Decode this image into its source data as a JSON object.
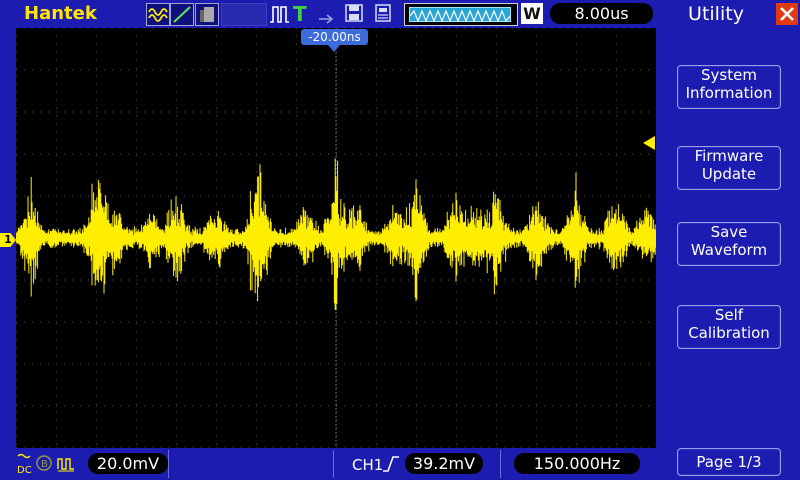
{
  "brand": "Hantek",
  "header": {
    "timebase": "8.00us",
    "memory_depth_label": "W",
    "trigger_status_icon": "T"
  },
  "screen": {
    "trigger_position": "-20.00ns",
    "channel_marker": "1"
  },
  "footer": {
    "ch1_coupling": "DC",
    "ch1_vdiv": "20.0mV",
    "trigger_source": "CH1",
    "trigger_level": "39.2mV",
    "frequency": "150.000Hz"
  },
  "menu": {
    "title": "Utility",
    "items": [
      {
        "line1": "System",
        "line2": "Information"
      },
      {
        "line1": "Firmware",
        "line2": "Update"
      },
      {
        "line1": "Save",
        "line2": "Waveform"
      },
      {
        "line1": "Self",
        "line2": "Calibration"
      }
    ],
    "page": "Page 1/3"
  },
  "colors": {
    "background": "#1c1cb0",
    "trace": "#ffee00",
    "screen": "#000000",
    "close": "#e03a12",
    "trigger_marker": "#3d6bdc"
  },
  "icons": [
    "wave-mode-icon",
    "line-mode-icon",
    "persistence-icon",
    "trigger-pulse-icon",
    "save-icon",
    "usb-icon",
    "close-icon",
    "rising-edge-icon"
  ]
}
